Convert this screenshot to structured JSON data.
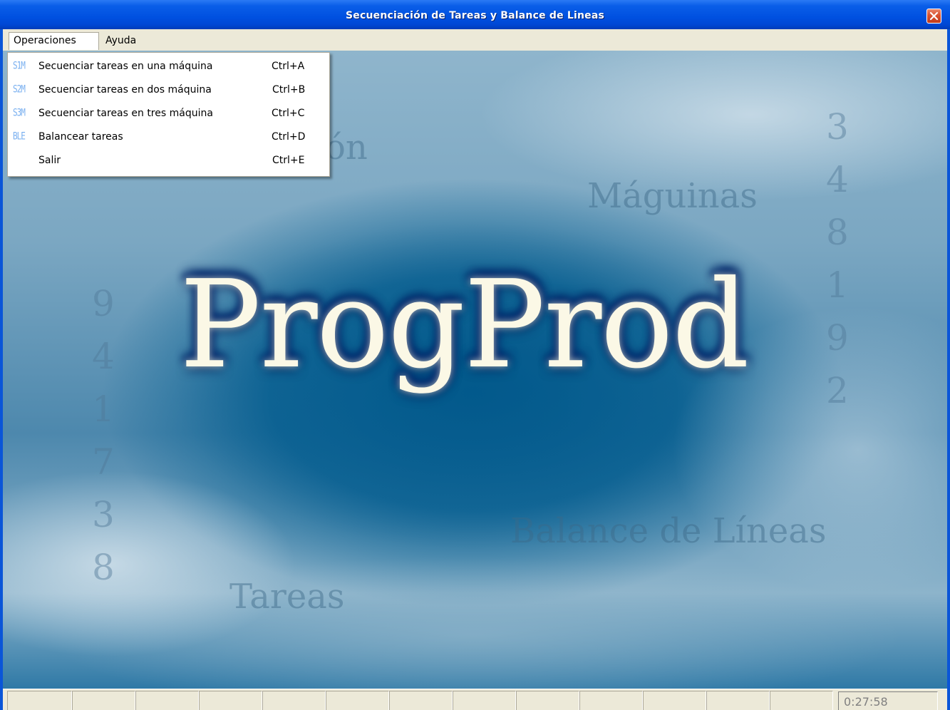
{
  "window": {
    "title": "Secuenciación de Tareas y  Balance de Lineas"
  },
  "menubar": {
    "items": [
      {
        "label": "Operaciones"
      },
      {
        "label": "Ayuda"
      }
    ]
  },
  "dropdown": {
    "items": [
      {
        "icon": "S1M",
        "label": "Secuenciar tareas en una máquina",
        "shortcut": "Ctrl+A"
      },
      {
        "icon": "S2M",
        "label": "Secuenciar tareas en dos máquina",
        "shortcut": "Ctrl+B"
      },
      {
        "icon": "S3M",
        "label": "Secuenciar tareas en tres máquina",
        "shortcut": "Ctrl+C"
      },
      {
        "icon": "BLE",
        "label": "Balancear tareas",
        "shortcut": "Ctrl+D"
      },
      {
        "icon": "",
        "label": "Salir",
        "shortcut": "Ctrl+E"
      }
    ]
  },
  "splash": {
    "logo": "ProgProd",
    "bg_words": {
      "on": "ón",
      "maquinas": "Máguinas",
      "balance": "Balance de Líneas",
      "tareas": "Tareas"
    },
    "digits_left": [
      "9",
      "4",
      "1",
      "7",
      "3",
      "8"
    ],
    "digits_right": [
      "3",
      "4",
      "8",
      "1",
      "9",
      "2"
    ]
  },
  "statusbar": {
    "clock": "0:27:58"
  },
  "colors": {
    "titlebar": "#0050e0",
    "menubar": "#ece9d8",
    "client_bg": "#0f6b9d",
    "logo": "#fbf8e6",
    "menu_icon": "#7ab0f0",
    "close_button": "#d9512e"
  }
}
